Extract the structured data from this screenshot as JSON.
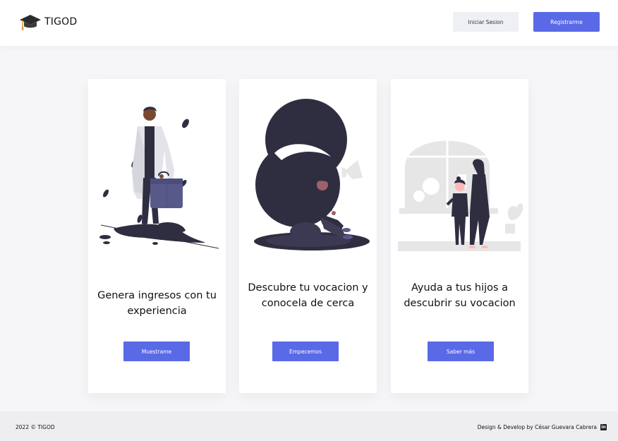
{
  "header": {
    "brand": "TIGOD",
    "login_label": "Iniciar Sesion",
    "register_label": "Registrarme"
  },
  "cards": [
    {
      "title": "Genera ingresos con tu experiencia",
      "button_label": "Muestrame",
      "illustration": "professional-with-briefcase"
    },
    {
      "title": "Descubre tu vocacion y conocela de cerca",
      "button_label": "Empecemos",
      "illustration": "person-sitting-thinking"
    },
    {
      "title": "Ayuda a tus hijos a descubrir su vocacion",
      "button_label": "Saber más",
      "illustration": "parent-and-child"
    }
  ],
  "footer": {
    "copyright": "2022 © TIGOD",
    "credit": "Design & Develop by César Guevara Cabrera",
    "linkedin_icon": "linkedin-icon"
  },
  "colors": {
    "accent": "#5a69e6",
    "page_bg": "#f6f6f9",
    "secondary_button": "#eef0f4",
    "illustration_dark": "#2f2e41",
    "illustration_purple": "#575a89",
    "illustration_gray": "#e6e6e6"
  }
}
